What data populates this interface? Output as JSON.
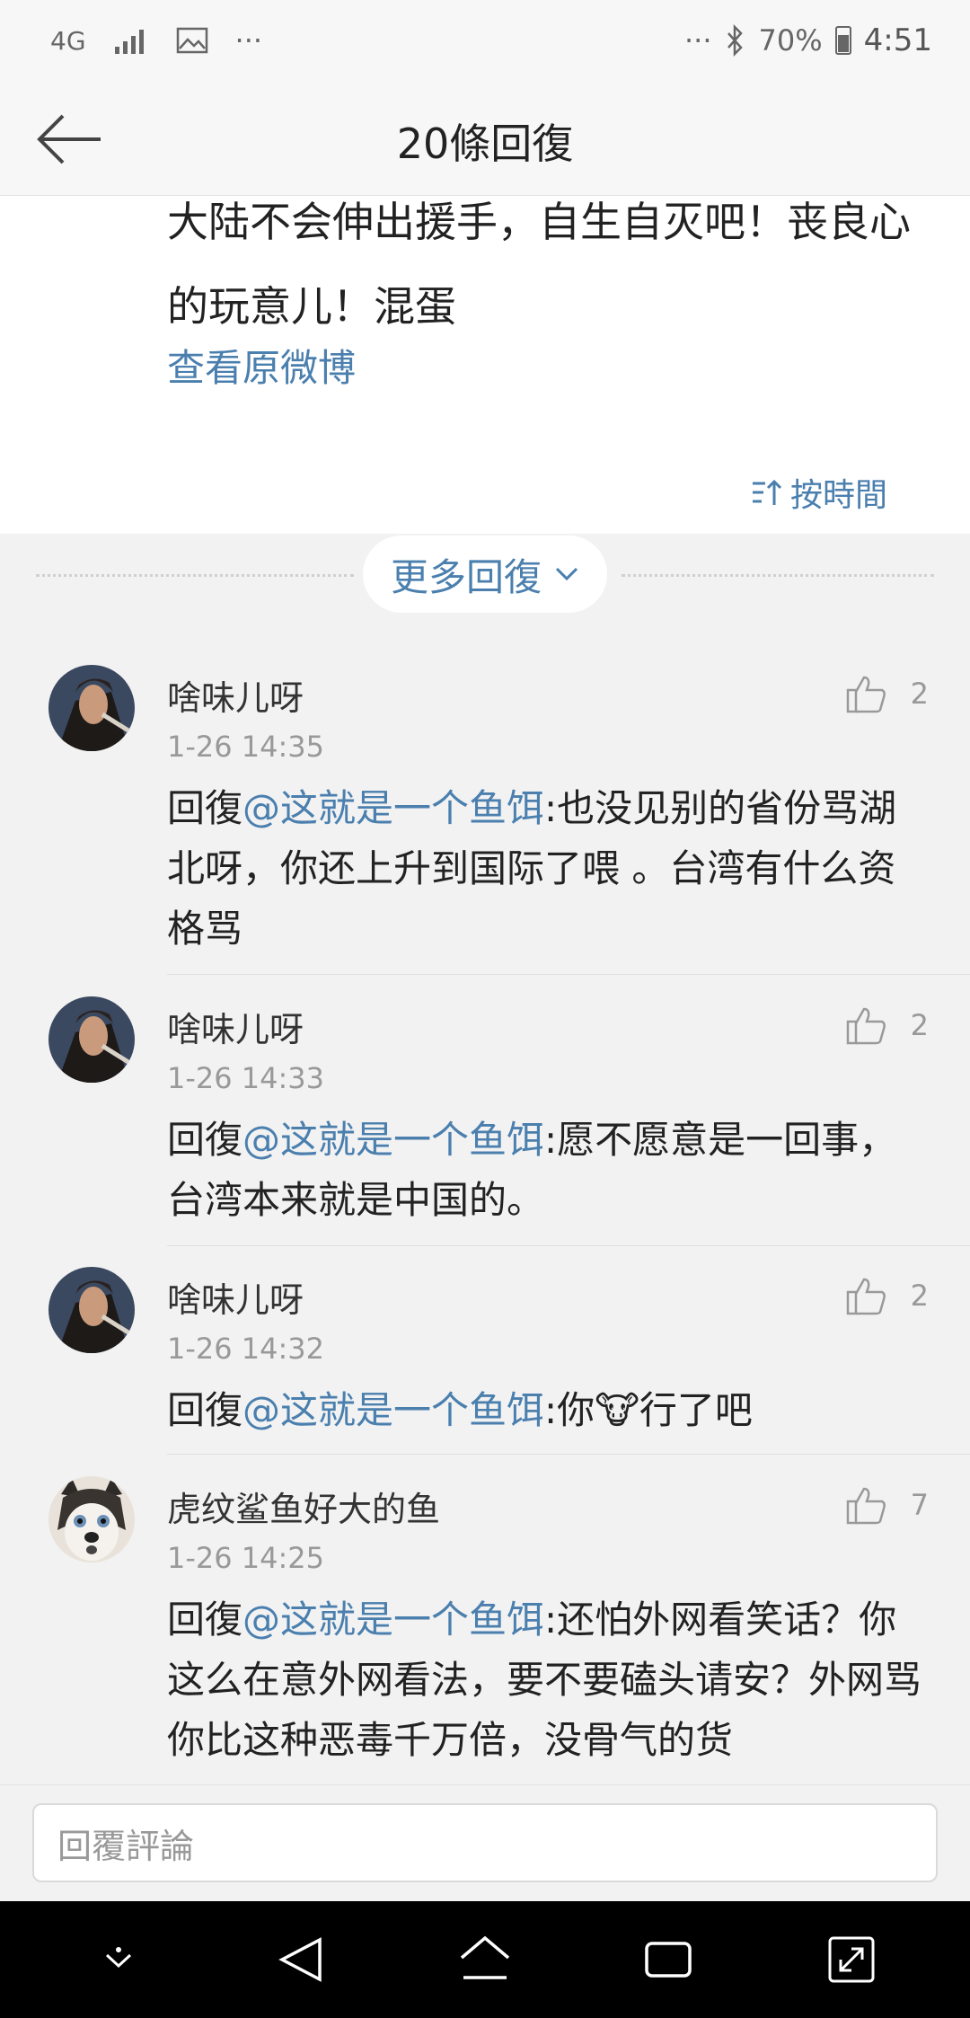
{
  "status_bar": {
    "network": "4G",
    "more": "···",
    "more_right": "···",
    "battery": "70%",
    "time": "4:51"
  },
  "nav": {
    "title": "20條回復"
  },
  "original": {
    "text": "大陆不会伸出援手，自生自灭吧！丧良心的玩意儿！混蛋",
    "view_original": "查看原微博",
    "sort_label": "按時間"
  },
  "more_replies": "更多回復",
  "comments": [
    {
      "name": "啥味儿呀",
      "time": "1-26 14:35",
      "likes": "2",
      "prefix": "回復",
      "mention": "@这就是一个鱼饵",
      "text": ":也没见别的省份骂湖北呀，你还上升到国际了喂 。台湾有什么资格骂"
    },
    {
      "name": "啥味儿呀",
      "time": "1-26 14:33",
      "likes": "2",
      "prefix": "回復",
      "mention": "@这就是一个鱼饵",
      "text": ":愿不愿意是一回事，台湾本来就是中国的。"
    },
    {
      "name": "啥味儿呀",
      "time": "1-26 14:32",
      "likes": "2",
      "prefix": "回復",
      "mention": "@这就是一个鱼饵",
      "text": ":你",
      "emoji": "🐮",
      "text_after": "行了吧"
    },
    {
      "name": "虎纹鲨鱼好大的鱼",
      "time": "1-26 14:25",
      "likes": "7",
      "prefix": "回復",
      "mention": "@这就是一个鱼饵",
      "text": ":还怕外网看笑话？你这么在意外网看法，要不要磕头请安？外网骂你比这种恶毒千万倍，没骨气的货"
    }
  ],
  "reply_bar": {
    "placeholder": "回覆評論"
  },
  "colors": {
    "link": "#4a7fae",
    "background": "#f2f2f2"
  }
}
